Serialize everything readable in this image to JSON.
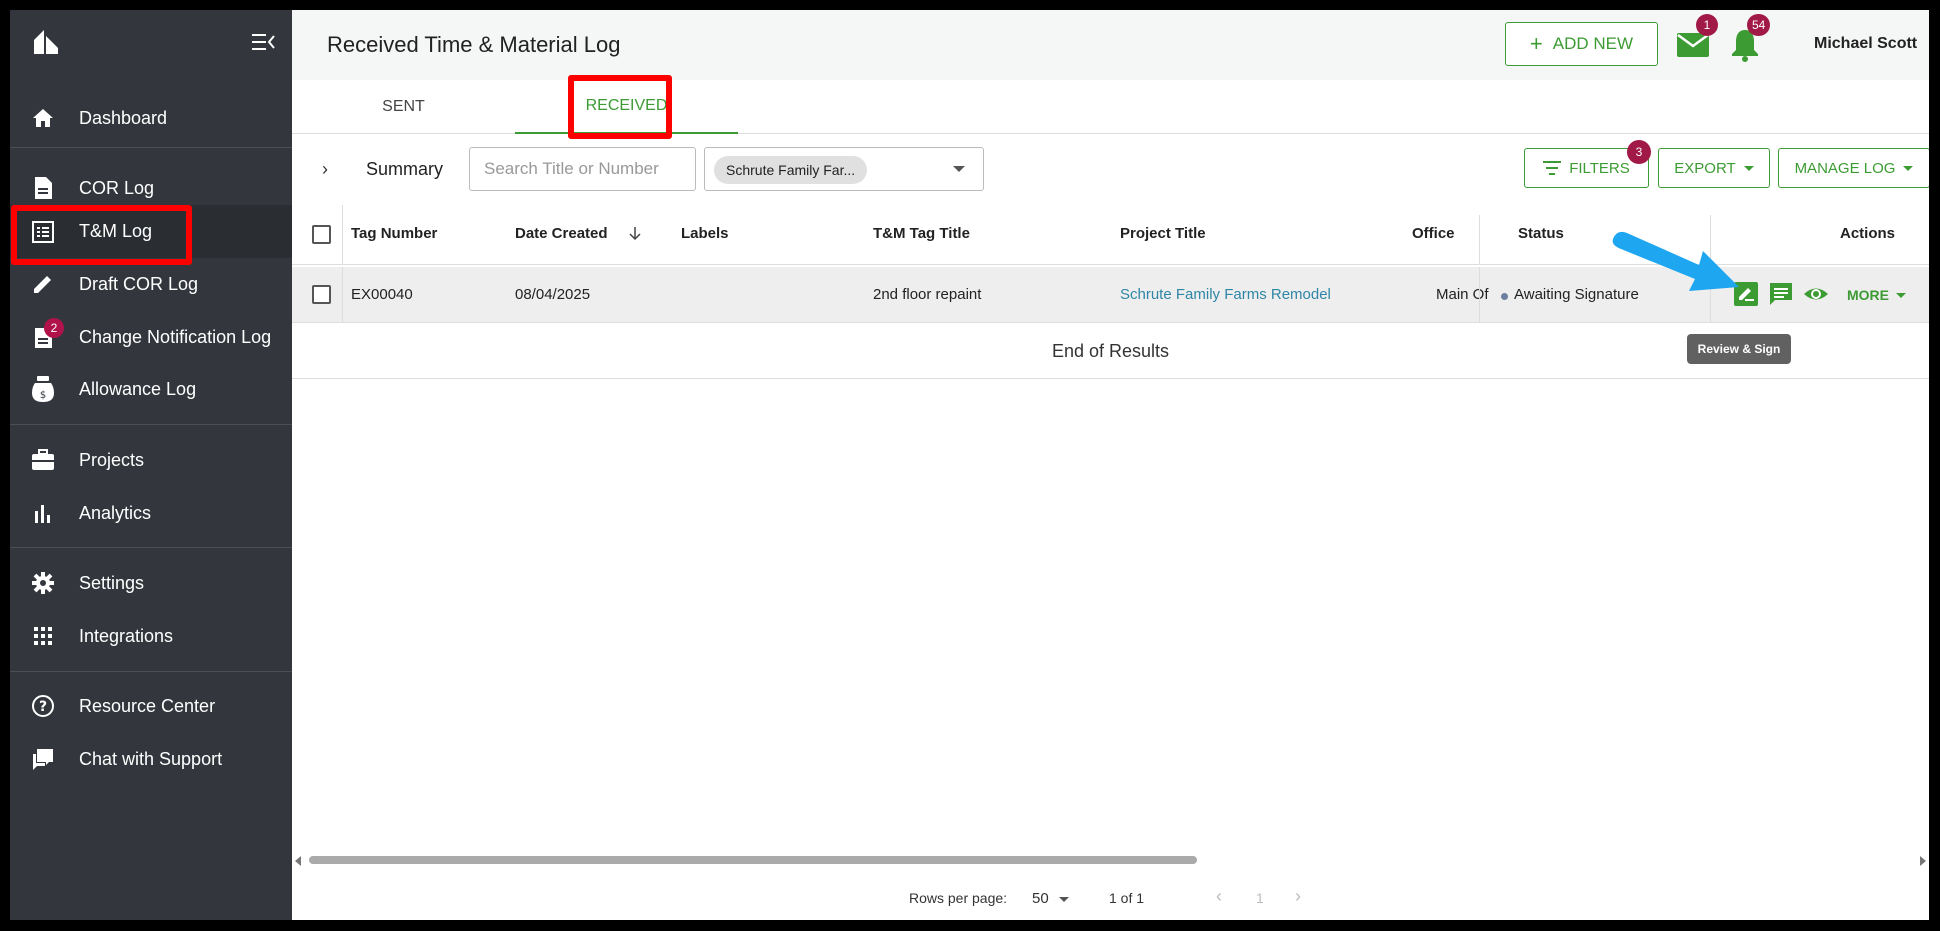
{
  "sidebar": {
    "items": [
      {
        "label": "Dashboard",
        "icon": "home-icon"
      },
      {
        "label": "COR Log",
        "icon": "document-icon"
      },
      {
        "label": "T&M Log",
        "icon": "list-icon"
      },
      {
        "label": "Draft COR Log",
        "icon": "pencil-icon"
      },
      {
        "label": "Change Notification Log",
        "icon": "notification-doc-icon",
        "badge": "2"
      },
      {
        "label": "Allowance Log",
        "icon": "money-bag-icon"
      },
      {
        "label": "Projects",
        "icon": "briefcase-icon"
      },
      {
        "label": "Analytics",
        "icon": "bar-chart-icon"
      },
      {
        "label": "Settings",
        "icon": "gear-icon"
      },
      {
        "label": "Integrations",
        "icon": "grid-icon"
      },
      {
        "label": "Resource Center",
        "icon": "help-icon"
      },
      {
        "label": "Chat with Support",
        "icon": "chat-icon"
      }
    ]
  },
  "header": {
    "title": "Received Time & Material Log",
    "add_new_label": "ADD NEW",
    "mail_badge": "1",
    "bell_badge": "54",
    "user_name": "Michael Scott"
  },
  "tabs": [
    {
      "label": "SENT"
    },
    {
      "label": "RECEIVED"
    }
  ],
  "toolbar": {
    "summary_label": "Summary",
    "search_placeholder": "Search Title or Number",
    "project_chip": "Schrute Family Far...",
    "filters_label": "FILTERS",
    "filters_badge": "3",
    "export_label": "EXPORT",
    "manage_label": "MANAGE LOG"
  },
  "table": {
    "columns": [
      "Tag Number",
      "Date Created",
      "Labels",
      "T&M Tag Title",
      "Project Title",
      "Office",
      "Status",
      "Actions"
    ],
    "rows": [
      {
        "tag_number": "EX00040",
        "date_created": "08/04/2025",
        "labels": "",
        "title": "2nd floor repaint",
        "project": "Schrute Family Farms Remodel",
        "office": "Main Of",
        "status": "Awaiting Signature",
        "more_label": "MORE"
      }
    ],
    "end_label": "End of Results",
    "tooltip": "Review & Sign"
  },
  "pagination": {
    "rows_per_page_label": "Rows per page:",
    "rows_per_page": "50",
    "range": "1 of 1",
    "page": "1"
  },
  "colors": {
    "sidebar": "#33373d",
    "accent_green": "#3c9b33",
    "badge": "#a11a47",
    "link": "#2f86a6",
    "annotation_red": "#ff0000",
    "annotation_arrow": "#1ea7f0"
  }
}
